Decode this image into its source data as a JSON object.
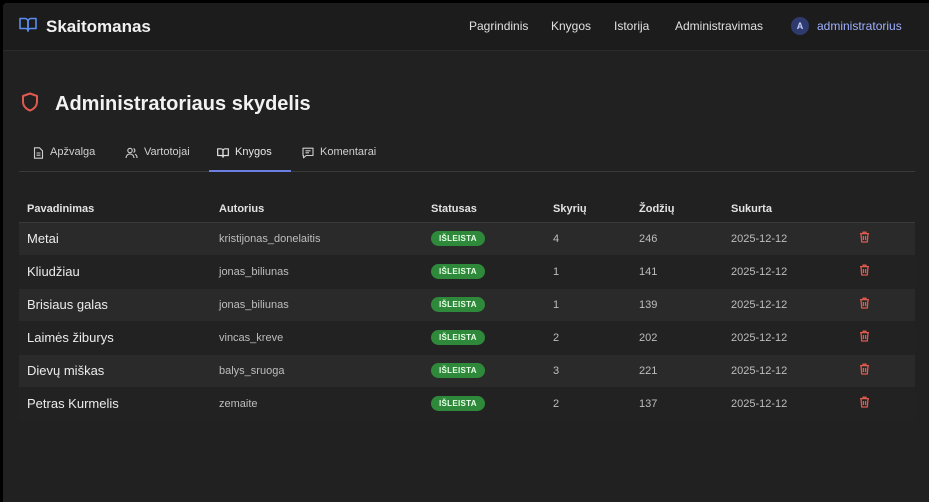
{
  "app": {
    "brand": "Skaitomanas"
  },
  "nav": {
    "items": [
      "Pagrindinis",
      "Knygos",
      "Istorija",
      "Administravimas"
    ],
    "user": {
      "avatar_letter": "A",
      "name": "administratorius"
    }
  },
  "page": {
    "title": "Administratoriaus skydelis"
  },
  "tabs": [
    {
      "label": "Apžvalga",
      "icon": "document-icon"
    },
    {
      "label": "Vartotojai",
      "icon": "users-icon"
    },
    {
      "label": "Knygos",
      "icon": "book-icon",
      "active": true
    },
    {
      "label": "Komentarai",
      "icon": "comment-icon"
    }
  ],
  "table": {
    "headers": [
      "Pavadinimas",
      "Autorius",
      "Statusas",
      "Skyrių",
      "Žodžių",
      "Sukurta"
    ],
    "rows": [
      {
        "title": "Metai",
        "author": "kristijonas_donelaitis",
        "status": "IŠLEISTA",
        "chapters": "4",
        "words": "246",
        "created": "2025-12-12"
      },
      {
        "title": "Kliudžiau",
        "author": "jonas_biliunas",
        "status": "IŠLEISTA",
        "chapters": "1",
        "words": "141",
        "created": "2025-12-12"
      },
      {
        "title": "Brisiaus galas",
        "author": "jonas_biliunas",
        "status": "IŠLEISTA",
        "chapters": "1",
        "words": "139",
        "created": "2025-12-12"
      },
      {
        "title": "Laimės žiburys",
        "author": "vincas_kreve",
        "status": "IŠLEISTA",
        "chapters": "2",
        "words": "202",
        "created": "2025-12-12"
      },
      {
        "title": "Dievų miškas",
        "author": "balys_sruoga",
        "status": "IŠLEISTA",
        "chapters": "3",
        "words": "221",
        "created": "2025-12-12"
      },
      {
        "title": "Petras Kurmelis",
        "author": "zemaite",
        "status": "IŠLEISTA",
        "chapters": "2",
        "words": "137",
        "created": "2025-12-12"
      }
    ]
  },
  "colors": {
    "accent": "#6b7fe0",
    "brand_icon": "#5b8def",
    "danger": "#e05a4f",
    "success": "#2e8a3a"
  }
}
